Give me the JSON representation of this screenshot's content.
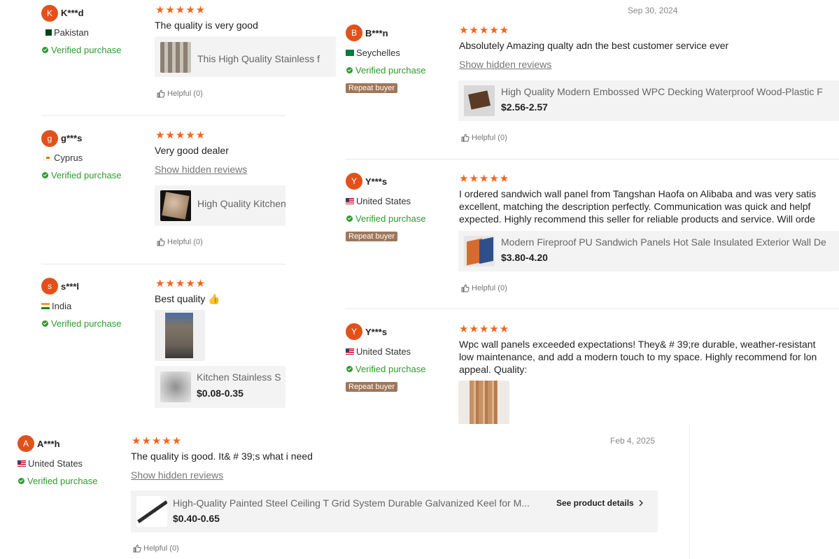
{
  "reviews": [
    {
      "avatar": "K",
      "user": "K***d",
      "country": "Pakistan",
      "verified": "Verified purchase",
      "stars": "★★★★★",
      "text": "The quality is very good",
      "product": {
        "name": "This High Quality Stainless f"
      },
      "helpful": "Helpful (0)"
    },
    {
      "avatar": "g",
      "user": "g***s",
      "country": "Cyprus",
      "verified": "Verified purchase",
      "stars": "★★★★★",
      "text": "Very good dealer",
      "hidden": "Show hidden reviews",
      "product": {
        "name": "High Quality Kitchen"
      },
      "helpful": "Helpful (0)"
    },
    {
      "avatar": "s",
      "user": "s***l",
      "country": "India",
      "verified": "Verified purchase",
      "stars": "★★★★★",
      "text": "Best quality 👍",
      "product": {
        "name": "Kitchen Stainless S",
        "price": "$0.08-0.35"
      },
      "helpful": ""
    },
    {
      "avatar": "B",
      "user": "B***n",
      "country": "Seychelles",
      "verified": "Verified purchase",
      "repeat": "Repeat buyer",
      "date": "Sep 30, 2024",
      "stars": "★★★★★",
      "text": "Absolutely Amazing qualty adn the best customer service ever",
      "hidden": "Show hidden reviews",
      "product": {
        "name": "High Quality Modern Embossed WPC Decking Waterproof Wood-Plastic F",
        "price": "$2.56-2.57"
      },
      "helpful": "Helpful (0)"
    },
    {
      "avatar": "Y",
      "user": "Y***s",
      "country": "United States",
      "verified": "Verified purchase",
      "repeat": "Repeat buyer",
      "stars": "★★★★★",
      "text_lines": [
        "I ordered sandwich wall panel from Tangshan Haofa on Alibaba and was very satis",
        "excellent, matching the description perfectly. Communication was quick and helpf",
        "expected. Highly recommend this seller for reliable products and service. Will orde"
      ],
      "product": {
        "name": "Modern Fireproof PU Sandwich Panels Hot Sale Insulated Exterior Wall De",
        "price": "$3.80-4.20"
      },
      "helpful": "Helpful (0)"
    },
    {
      "avatar": "Y",
      "user": "Y***s",
      "country": "United States",
      "verified": "Verified purchase",
      "repeat": "Repeat buyer",
      "stars": "★★★★★",
      "text_lines": [
        "Wpc wall panels exceeded expectations! They& # 39;re durable, weather-resistant",
        "low maintenance, and add a modern touch to my space. Highly recommend for lon",
        "appeal. Quality:"
      ]
    },
    {
      "avatar": "A",
      "user": "A***h",
      "country": "United States",
      "verified": "Verified purchase",
      "date": "Feb 4, 2025",
      "stars": "★★★★★",
      "text": "The quality is good. It& # 39;s what i need",
      "hidden": "Show hidden reviews",
      "product": {
        "name": "High-Quality Painted Steel Ceiling T Grid System Durable Galvanized Keel for M...",
        "price": "$0.40-0.65",
        "details": "See product details"
      },
      "helpful": "Helpful (0)"
    }
  ],
  "colors": {
    "star": "#f2661e",
    "verified": "#2e9a2e",
    "avatar": "#e2511b",
    "repeat_badge": "#a07658"
  }
}
